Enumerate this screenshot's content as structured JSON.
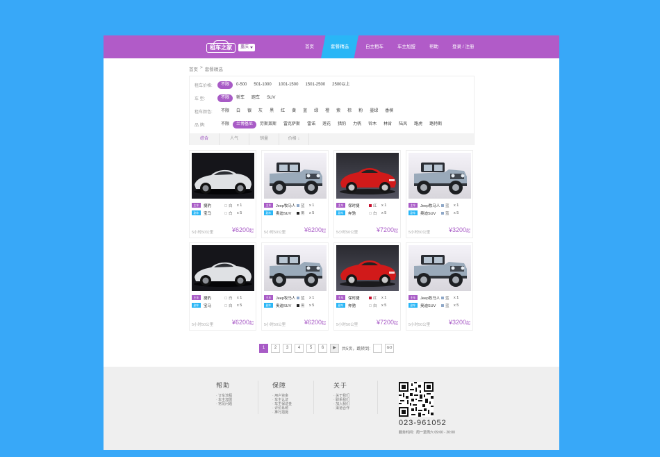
{
  "header": {
    "logo_text": "租车之家",
    "city": "重庆",
    "nav": [
      "首页",
      "套餐精选",
      "自主租车",
      "车主加盟",
      "帮助",
      "登录 / 注册"
    ],
    "active_nav": 1
  },
  "breadcrumb": [
    "首页",
    ">",
    "套餐精选"
  ],
  "filters": [
    {
      "label": "租车价格:",
      "options": [
        "不限",
        "0-500",
        "501-1000",
        "1001-1500",
        "1501-2500",
        "2500以上"
      ],
      "selected": 0
    },
    {
      "label": "车    型:",
      "options": [
        "不限",
        "轿车",
        "跑车",
        "SUV"
      ],
      "selected": 0
    },
    {
      "label": "租车颜色:",
      "options": [
        "不限",
        "白",
        "银",
        "灰",
        "黑",
        "红",
        "黄",
        "蓝",
        "绿",
        "橙",
        "紫",
        "棕",
        "粉",
        "墨绿",
        "香槟"
      ],
      "selected": -1
    },
    {
      "label": "品    牌:",
      "options": [
        "不限",
        "兰博基尼",
        "劳斯莱斯",
        "雷克萨斯",
        "雷诺",
        "莲花",
        "猎豹",
        "力帆",
        "铃木",
        "林肯",
        "陆风",
        "路虎",
        "路特斯"
      ],
      "selected": 1
    }
  ],
  "sort": [
    "综合",
    "人气",
    "销量",
    "价格 ↓"
  ],
  "products": [
    {
      "photo": "dark",
      "car": "jaguar",
      "r1": {
        "tag": "主车",
        "name": "捷豹",
        "color": "白",
        "swatch": "#ffffff",
        "qty": "x 1"
      },
      "r2": {
        "tag": "副车",
        "name": "宝马",
        "color": "白",
        "swatch": "#ffffff",
        "qty": "x 5"
      },
      "dist": "5小时50公里",
      "price": "¥6200",
      "unit": "起"
    },
    {
      "photo": "light",
      "car": "jeep",
      "r1": {
        "tag": "主车",
        "name": "Jeep牧马人",
        "color": "蓝",
        "swatch": "#8fa8c8",
        "qty": "x 1"
      },
      "r2": {
        "tag": "副车",
        "name": "奥迪SUV",
        "color": "黑",
        "swatch": "#222222",
        "qty": "x 5"
      },
      "dist": "5小时50公里",
      "price": "¥6200",
      "unit": "起"
    },
    {
      "photo": "red",
      "car": "porsche",
      "r1": {
        "tag": "主车",
        "name": "保时捷",
        "color": "红",
        "swatch": "#c8102e",
        "qty": "x 1"
      },
      "r2": {
        "tag": "副车",
        "name": "奔驰",
        "color": "白",
        "swatch": "#ffffff",
        "qty": "x 5"
      },
      "dist": "5小时50公里",
      "price": "¥7200",
      "unit": "起"
    },
    {
      "photo": "light",
      "car": "jeep",
      "r1": {
        "tag": "主车",
        "name": "Jeep牧马人",
        "color": "蓝",
        "swatch": "#8fa8c8",
        "qty": "x 1"
      },
      "r2": {
        "tag": "副车",
        "name": "奥迪SUV",
        "color": "蓝",
        "swatch": "#8fa8c8",
        "qty": "x 5"
      },
      "dist": "5小时50公里",
      "price": "¥3200",
      "unit": "起"
    },
    {
      "photo": "dark",
      "car": "jaguar",
      "r1": {
        "tag": "主车",
        "name": "捷豹",
        "color": "白",
        "swatch": "#ffffff",
        "qty": "x 1"
      },
      "r2": {
        "tag": "副车",
        "name": "宝马",
        "color": "白",
        "swatch": "#ffffff",
        "qty": "x 5"
      },
      "dist": "5小时50公里",
      "price": "¥6200",
      "unit": "起"
    },
    {
      "photo": "light",
      "car": "jeep",
      "r1": {
        "tag": "主车",
        "name": "Jeep牧马人",
        "color": "蓝",
        "swatch": "#8fa8c8",
        "qty": "x 1"
      },
      "r2": {
        "tag": "副车",
        "name": "奥迪SUV",
        "color": "黑",
        "swatch": "#222222",
        "qty": "x 5"
      },
      "dist": "5小时50公里",
      "price": "¥6200",
      "unit": "起"
    },
    {
      "photo": "red",
      "car": "porsche",
      "r1": {
        "tag": "主车",
        "name": "保时捷",
        "color": "红",
        "swatch": "#c8102e",
        "qty": "x 1"
      },
      "r2": {
        "tag": "副车",
        "name": "奔驰",
        "color": "白",
        "swatch": "#ffffff",
        "qty": "x 5"
      },
      "dist": "5小时50公里",
      "price": "¥7200",
      "unit": "起"
    },
    {
      "photo": "light",
      "car": "jeep",
      "r1": {
        "tag": "主车",
        "name": "Jeep牧马人",
        "color": "蓝",
        "swatch": "#8fa8c8",
        "qty": "x 1"
      },
      "r2": {
        "tag": "副车",
        "name": "奥迪SUV",
        "color": "蓝",
        "swatch": "#8fa8c8",
        "qty": "x 5"
      },
      "dist": "5小时50公里",
      "price": "¥3200",
      "unit": "起"
    }
  ],
  "pagination": {
    "pages": [
      "1",
      "2",
      "3",
      "4",
      "5",
      "6"
    ],
    "current": "1",
    "next": "▶",
    "summary": "共5页，跳转到:",
    "go": "GO"
  },
  "footer": {
    "cols": [
      {
        "title": "帮助",
        "links": [
          "订车流程",
          "车主加盟",
          "常见问题"
        ]
      },
      {
        "title": "保障",
        "links": [
          "用户资金",
          "车主认证",
          "车主保证金",
          "评价系统",
          "推行措施"
        ]
      },
      {
        "title": "关于",
        "links": [
          "关于我们",
          "联系我们",
          "加入我们",
          "渠道合作"
        ]
      }
    ],
    "phone": "023-961052",
    "hours": "服务时间：周一至周六 09:00 - 20:00"
  },
  "colors": {
    "brand_purple": "#b15bc8",
    "accent_blue": "#29b6f6",
    "bg_blue": "#38a8f8"
  }
}
